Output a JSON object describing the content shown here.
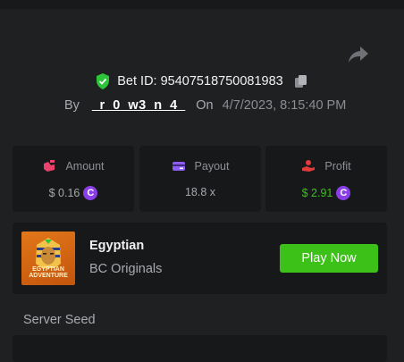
{
  "bet": {
    "id_text": "Bet ID: 95407518750081983",
    "by_label": "By",
    "username": "_r_0_w3_n_4_",
    "on_label": "On",
    "timestamp": "4/7/2023, 8:15:40 PM"
  },
  "stats": {
    "amount": {
      "label": "Amount",
      "value": "$ 0.16",
      "currency_icon": "bc-coin-icon"
    },
    "payout": {
      "label": "Payout",
      "value": "18.8 x"
    },
    "profit": {
      "label": "Profit",
      "value": "$ 2.91",
      "currency_icon": "bc-coin-icon"
    }
  },
  "game": {
    "title": "Egyptian",
    "provider": "BC Originals",
    "thumbnail_text": "EGYPTIAN ADVENTURE",
    "play_label": "Play Now"
  },
  "seed": {
    "label": "Server Seed"
  },
  "colors": {
    "accent_green": "#3bc117",
    "profit_green": "#3bc117",
    "coin_purple": "#8a3ee8",
    "amount_icon": "#e9436b",
    "payout_icon": "#8c5cf5",
    "profit_icon": "#e33a3a"
  }
}
